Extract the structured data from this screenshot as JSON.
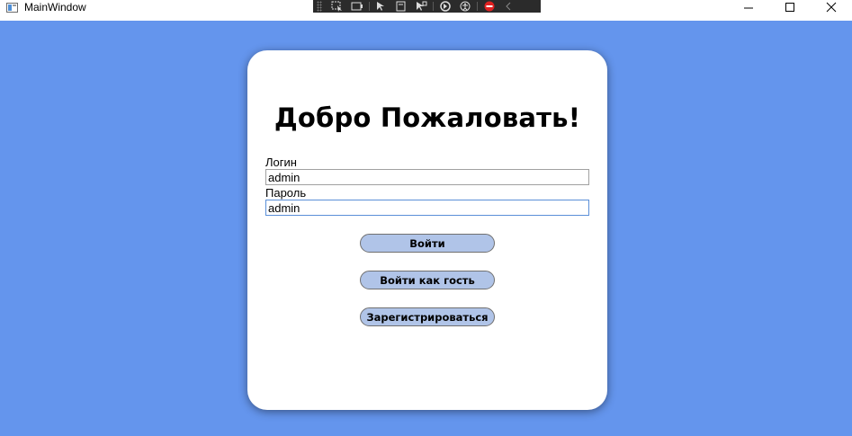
{
  "window": {
    "title": "MainWindow",
    "icon": "app-window-icon",
    "controls": [
      "minimize-icon",
      "maximize-icon",
      "close-icon"
    ]
  },
  "debug_toolbar": {
    "icons": [
      "select-element-icon",
      "display-layout-adorners-icon",
      "track-focused-element-icon",
      "pointer-icon",
      "layout-icon",
      "select-icon",
      "hot-reload-icon",
      "accessibility-icon",
      "binding-failures-icon",
      "collapse-chevron-icon"
    ]
  },
  "colors": {
    "background": "#6495ed",
    "card": "#ffffff",
    "button": "#b0c4e8",
    "focus_border": "#5b8fd8"
  },
  "card": {
    "heading": "Добро Пожаловать!",
    "login": {
      "label": "Логин",
      "value": "admin"
    },
    "password": {
      "label": "Пароль",
      "value": "admin"
    },
    "buttons": {
      "login": "Войти",
      "guest": "Войти как гость",
      "register": "Зарегистрироваться"
    }
  }
}
